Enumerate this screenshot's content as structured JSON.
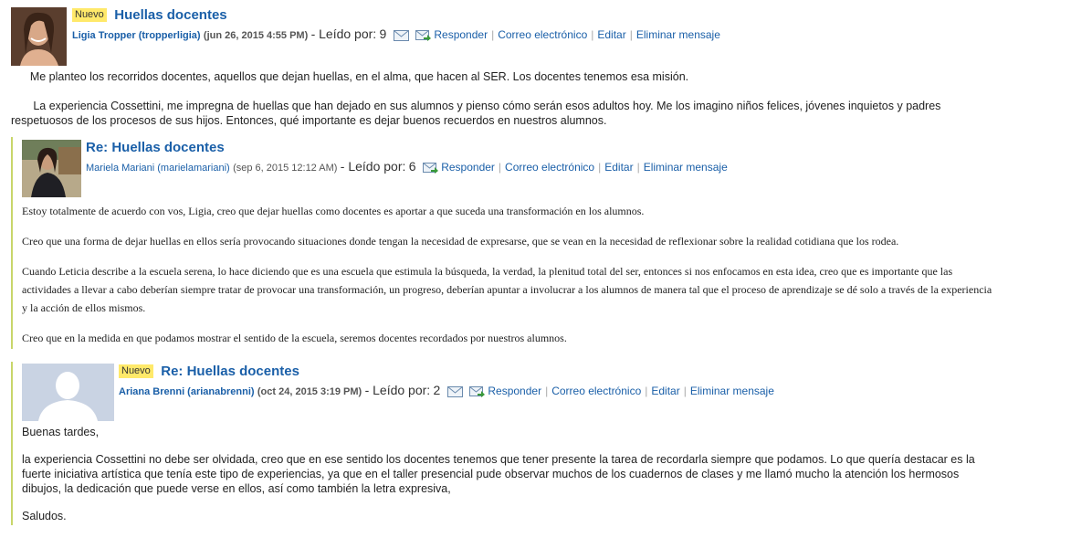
{
  "posts": [
    {
      "badge": "Nuevo",
      "title": "Huellas docentes",
      "author": "Ligia Tropper (tropperligia)",
      "date": "(jun 26, 2015 4:55 PM)",
      "read_label": "- Leído por:",
      "read_count": "9",
      "actions": [
        "Responder",
        "Correo electrónico",
        "Editar",
        "Eliminar mensaje"
      ],
      "paragraphs": [
        "      Me planteo los recorridos docentes, aquellos que dejan huellas, en el alma, que hacen al SER. Los docentes tenemos esa misión.",
        "       La experiencia Cossettini, me impregna de huellas que han dejado en sus alumnos y pienso cómo serán esos adultos hoy. Me los imagino niños felices, jóvenes inquietos y padres respetuosos de los procesos de sus hijos. Entonces, qué importante es dejar buenos recuerdos en nuestros alumnos."
      ]
    },
    {
      "title": "Re: Huellas docentes",
      "author": "Mariela Mariani (marielamariani)",
      "date": "(sep 6, 2015 12:12 AM)",
      "read_label": "- Leído por:",
      "read_count": "6",
      "actions": [
        "Responder",
        "Correo electrónico",
        "Editar",
        "Eliminar mensaje"
      ],
      "paragraphs": [
        "Estoy totalmente de acuerdo con vos, Ligia, creo que dejar huellas como docentes es aportar a que suceda una transformación en los alumnos.",
        "Creo que una forma de dejar huellas en ellos sería provocando situaciones donde tengan la necesidad de expresarse, que se vean en la necesidad de reflexionar sobre la realidad cotidiana que los rodea.",
        "Cuando Leticia describe a la escuela serena, lo hace diciendo que es una escuela que estimula la búsqueda, la verdad, la plenitud total del ser, entonces si nos enfocamos en esta idea, creo que es importante que las actividades a llevar a cabo deberían siempre tratar de provocar una transformación, un progreso, deberían apuntar a involucrar a los alumnos de manera tal que el proceso de aprendizaje se dé solo a través de la experiencia y la acción de ellos mismos.",
        "Creo que en la medida en que podamos mostrar el sentido de la escuela, seremos docentes recordados por nuestros alumnos."
      ]
    },
    {
      "badge": "Nuevo",
      "title": "Re: Huellas docentes",
      "author": "Ariana Brenni (arianabrenni)",
      "date": "(oct 24, 2015 3:19 PM)",
      "read_label": "- Leído por:",
      "read_count": "2",
      "actions": [
        "Responder",
        "Correo electrónico",
        "Editar",
        "Eliminar mensaje"
      ],
      "paragraphs": [
        "Buenas tardes,",
        "la experiencia Cossettini no debe ser olvidada, creo que en ese sentido los docentes tenemos que tener presente la tarea de recordarla siempre que podamos. Lo que quería destacar es la fuerte iniciativa artística que tenía este tipo de experiencias, ya que en el taller presencial pude observar muchos de los cuadernos de clases y me llamó mucho la atención los hermosos dibujos, la dedicación que puede verse en ellos, así como también la letra expresiva,",
        "Saludos."
      ]
    }
  ]
}
